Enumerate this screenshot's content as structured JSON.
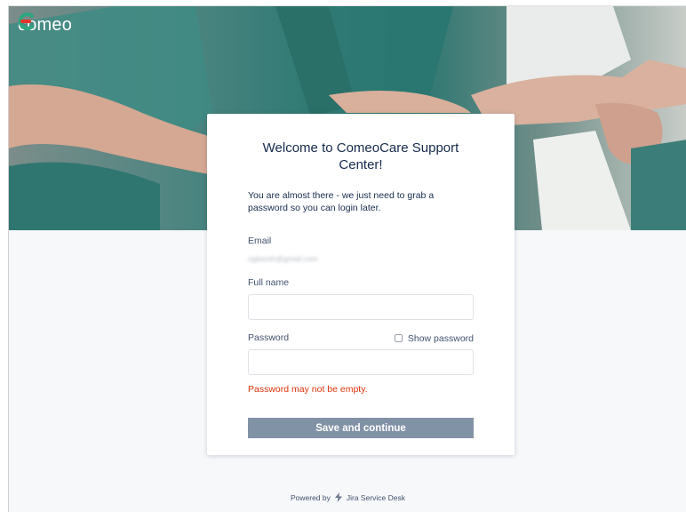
{
  "brand": {
    "name": "comeo",
    "accent_color": "#e8352a",
    "logo_color": "#2e9a7e"
  },
  "form": {
    "title": "Welcome to ComeoCare Support Center!",
    "intro": "You are almost there - we just need to grab a password so you can login later.",
    "email_label": "Email",
    "email_value": "ogbarah@gmail.com",
    "fullname_label": "Full name",
    "fullname_value": "",
    "password_label": "Password",
    "password_value": "",
    "show_password_label": "Show password",
    "show_password_checked": false,
    "error_message": "Password may not be empty.",
    "submit_label": "Save and continue"
  },
  "footer": {
    "powered_by": "Powered by",
    "product": "Jira Service Desk",
    "icon": "jira-bolt-icon"
  },
  "colors": {
    "error": "#de350b",
    "button_disabled": "#8292a6",
    "heading": "#172b4d"
  }
}
